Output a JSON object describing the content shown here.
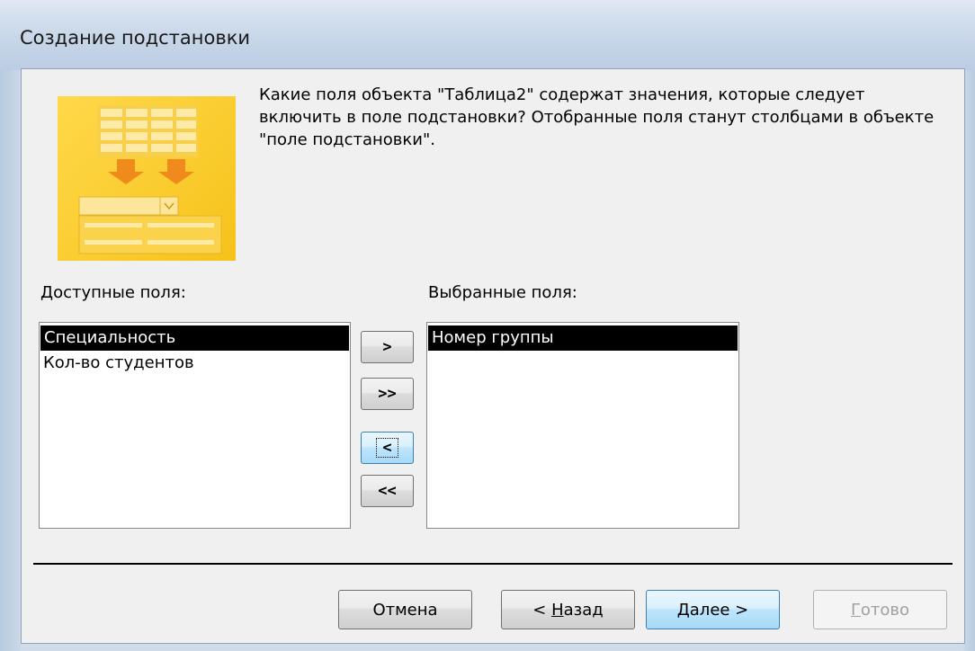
{
  "window": {
    "title": "Создание подстановки"
  },
  "description": "Какие поля объекта \"Таблица2\" содержат значения, которые следует включить в поле подстановки? Отобранные поля станут столбцами в объекте \"поле подстановки\".",
  "available": {
    "label": "Доступные поля:",
    "items": [
      "Специальность",
      "Кол-во студентов"
    ],
    "selected_index": 0
  },
  "selected": {
    "label": "Выбранные поля:",
    "items": [
      "Номер группы"
    ],
    "selected_index": 0
  },
  "move_buttons": {
    "add_one": ">",
    "add_all": ">>",
    "remove_one": "<",
    "remove_all": "<<"
  },
  "footer": {
    "cancel": "Отмена",
    "back_prefix": "< ",
    "back_accel": "Н",
    "back_rest": "азад",
    "next_accel": "Д",
    "next_rest": "алее >",
    "finish_accel": "Г",
    "finish_rest": "отово"
  },
  "colors": {
    "illustration": "#f6c21a",
    "selection": "#000000",
    "titlebar": "#c7d6e8"
  },
  "icons": {
    "illustration": "lookup-wizard-icon"
  }
}
